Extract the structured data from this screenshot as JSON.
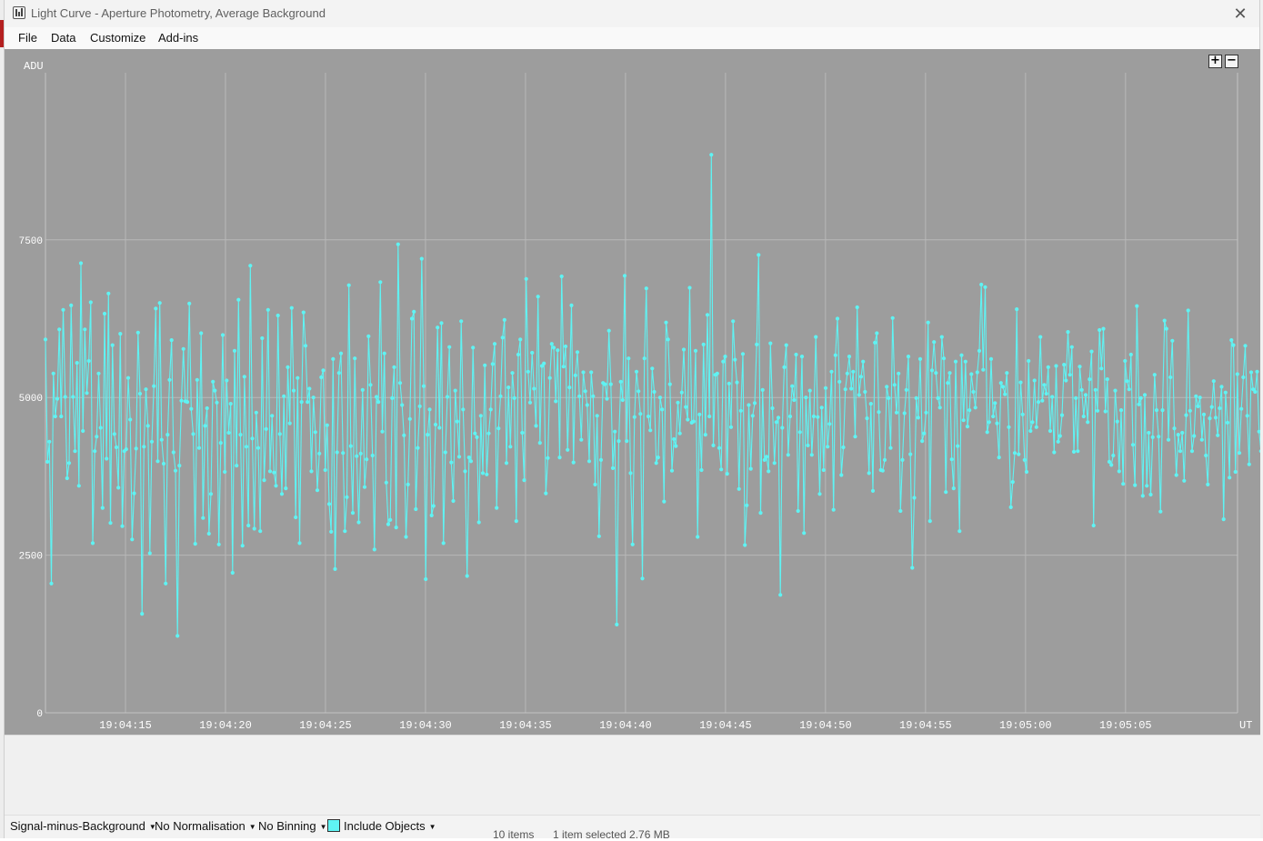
{
  "window": {
    "title": "Light Curve - Aperture Photometry, Average Background",
    "close_glyph": "✕"
  },
  "menu": [
    "File",
    "Data",
    "Customize",
    "Add-ins"
  ],
  "plot": {
    "zoom_in": "+",
    "zoom_out": "−"
  },
  "statusbar": {
    "signal_mode": "Signal-minus-Background",
    "normalisation": "No Normalisation",
    "binning": "No Binning",
    "include_objects": "Include Objects",
    "include_objects_color": "#5ff3f3"
  },
  "background_peek": {
    "items": "10 items",
    "selected": "1 item selected  2.76 MB"
  },
  "chart_data": {
    "type": "line",
    "ylabel": "ADU",
    "xlabel": "UT",
    "ylim": [
      0,
      10150
    ],
    "xlim": [
      "19:04:11.0",
      "19:05:10.6"
    ],
    "yticks": [
      0,
      2500,
      5000,
      7500
    ],
    "xticks": [
      "19:04:15",
      "19:04:20",
      "19:04:25",
      "19:04:30",
      "19:04:35",
      "19:04:40",
      "19:04:45",
      "19:04:50",
      "19:04:55",
      "19:05:00",
      "19:05:05"
    ],
    "grid": true,
    "series_color": "#5ff3f3",
    "point_interval_s": 0.0985,
    "series": [
      {
        "values": [
          5920,
          3980,
          4300,
          2050,
          5380,
          4700,
          4980,
          6080,
          4700,
          6390,
          5010,
          3720,
          3960,
          6460,
          5010,
          4150,
          5550,
          3600,
          7130,
          4470,
          6080,
          5070,
          5580,
          6510,
          2690,
          4150,
          4380,
          5380,
          4520,
          3250,
          6330,
          4030,
          6650,
          3010,
          5830,
          4420,
          4210,
          3570,
          6010,
          2960,
          4150,
          4180,
          5310,
          4650,
          2750,
          3480,
          4190,
          6030,
          5060,
          1570,
          4220,
          5130,
          4550,
          2530,
          4300,
          5180,
          6410,
          3990,
          6500,
          4330,
          3950,
          2050,
          4410,
          5280,
          5910,
          4130,
          3840,
          1220,
          3920,
          4950,
          5770,
          4940,
          4930,
          6490,
          4820,
          4420,
          2680,
          5280,
          4200,
          6020,
          3090,
          4550,
          4830,
          2840,
          3470,
          5250,
          5110,
          4920,
          2670,
          4280,
          5990,
          3820,
          5270,
          4440,
          4900,
          2220,
          5740,
          3920,
          6550,
          4410,
          2650,
          5330,
          4220,
          2970,
          7090,
          4350,
          2920,
          4760,
          4200,
          2880,
          5940,
          3690,
          4500,
          6390,
          3830,
          4710,
          3810,
          3600,
          6300,
          4420,
          3470,
          5020,
          3560,
          5480,
          4590,
          6420,
          5110,
          3100,
          5310,
          2690,
          4930,
          6350,
          5820,
          4930,
          5140,
          3830,
          5000,
          4450,
          3530,
          4110,
          5320,
          5430,
          3850,
          4560,
          3310,
          2870,
          5610,
          2280,
          4130,
          5390,
          5700,
          4120,
          2880,
          3420,
          6780,
          4230,
          3170,
          5620,
          4070,
          3020,
          4110,
          5120,
          3580,
          4020,
          5970,
          5200,
          4080,
          2590,
          5010,
          4930,
          6830,
          4460,
          5700,
          3650,
          2990,
          3060,
          4990,
          5480,
          2940,
          7430,
          5230,
          4880,
          4400,
          2790,
          3620,
          4660,
          6250,
          6360,
          3230,
          4200,
          4860,
          7200,
          5180,
          2120,
          4410,
          4810,
          3130,
          3280,
          4570,
          6110,
          4520,
          6180,
          2690,
          4130,
          5010,
          5800,
          3970,
          3360,
          5110,
          4620,
          4060,
          6210,
          4810,
          3830,
          2170,
          4050,
          3990,
          5790,
          4430,
          4370,
          3020,
          4710,
          3800,
          5510,
          3780,
          4430,
          4810,
          5530,
          5850,
          3250,
          4510,
          5020,
          5950,
          6230,
          3960,
          5160,
          4220,
          5390,
          4990,
          3040,
          5680,
          5920,
          4440,
          3690,
          6880,
          5410,
          4920,
          5710,
          5140,
          4550,
          6600,
          4280,
          5500,
          5540,
          3480,
          4040,
          5310,
          5850,
          5790,
          4940,
          5750,
          4050,
          6920,
          5490,
          5810,
          4170,
          5160,
          6460,
          3970,
          5350,
          5720,
          5020,
          4330,
          5400,
          5100,
          4880,
          3990,
          5400,
          5020,
          3620,
          4710,
          2800,
          4010,
          5230,
          5210,
          4980,
          6060,
          5210,
          3880,
          4460,
          1400,
          4310,
          5250,
          4960,
          6930,
          4310,
          5620,
          3800,
          2670,
          4690,
          5410,
          5100,
          4740,
          2130,
          5620,
          6730,
          4700,
          4480,
          5460,
          5090,
          3960,
          4050,
          5000,
          4810,
          3350,
          6190,
          5920,
          5210,
          3840,
          4340,
          4230,
          4920,
          4430,
          5080,
          5760,
          4850,
          4650,
          6740,
          4600,
          4620,
          5740,
          2790,
          4730,
          3850,
          5840,
          4410,
          6310,
          4700,
          8850,
          4240,
          5360,
          5380,
          4200,
          3860,
          5570,
          5650,
          3790,
          5220,
          4530,
          6210,
          5600,
          5240,
          3550,
          4790,
          5690,
          2660,
          3290,
          4880,
          3870,
          4710,
          4910,
          5840,
          7260,
          3170,
          5120,
          4010,
          4060,
          3830,
          5860,
          4830,
          3960,
          4610,
          4680,
          1870,
          4520,
          5480,
          5830,
          4090,
          4700,
          5180,
          4960,
          5680,
          3200,
          4450,
          5650,
          2850,
          5000,
          4240,
          5110,
          4090,
          4700,
          5960,
          4690,
          3470,
          4840,
          3850,
          5150,
          4220,
          4580,
          5410,
          3220,
          5670,
          6250,
          5250,
          3770,
          4210,
          5130,
          5380,
          5650,
          5140,
          5410,
          4380,
          6430,
          5040,
          5330,
          5570,
          5090,
          4670,
          3800,
          4900,
          3520,
          5870,
          6020,
          4770,
          3850,
          3840,
          4010,
          5170,
          4990,
          4200,
          6260,
          5200,
          4760,
          5380,
          3200,
          4010,
          4750,
          5120,
          5650,
          4100,
          2300,
          3410,
          4990,
          4680,
          5610,
          4310,
          4430,
          4760,
          6190,
          3040,
          5430,
          5880,
          5390,
          4990,
          4840,
          5960,
          5620,
          3500,
          5230,
          5390,
          4020,
          3560,
          5570,
          4230,
          2880,
          5670,
          4640,
          5570,
          4540,
          4800,
          5370,
          5090,
          4840,
          5400,
          5740,
          6790,
          5440,
          6750,
          4450,
          4610,
          5610,
          4700,
          4910,
          4590,
          4050,
          5230,
          5170,
          5050,
          5390,
          4530,
          3260,
          3660,
          4120,
          6400,
          4100,
          5240,
          4730,
          4010,
          3820,
          5580,
          4470,
          4610,
          5270,
          4530,
          4930,
          5960,
          4950,
          5200,
          5060,
          5480,
          4470,
          5010,
          4130,
          5500,
          4300,
          4390,
          4720,
          5520,
          5270,
          6040,
          5360,
          5800,
          4140,
          4990,
          4150,
          5490,
          5120,
          4700,
          5040,
          4610,
          5290,
          5730,
          2970,
          5120,
          4790,
          6070,
          5460,
          6090,
          4780,
          5290,
          3980,
          3930,
          4080,
          5110,
          4620,
          3830,
          4800,
          3630,
          5580,
          5260,
          5130,
          5680,
          4250,
          3610,
          6450,
          4890,
          4990,
          3440,
          5040,
          3600,
          4440,
          3460,
          4370,
          5360,
          4800,
          4380,
          3190,
          4800,
          6220,
          6090,
          4330,
          5320,
          5900,
          4510,
          3770,
          4410,
          4150,
          4440,
          3680,
          4720,
          6380,
          4790,
          4150,
          4390,
          5020,
          4860,
          5000,
          4330,
          4730,
          4080,
          3620,
          4670,
          4850,
          5260,
          4680,
          4400,
          4830,
          5170,
          3070,
          5080,
          4600,
          3730,
          5910,
          5830,
          3820,
          5370,
          4120,
          4820,
          5320,
          5820,
          4710,
          3940,
          5400,
          5130,
          5090,
          5410,
          4460,
          4150,
          4810,
          4620,
          4120,
          4460,
          4600,
          4630,
          5040,
          4000,
          4860,
          4280,
          3420,
          3760,
          3030,
          5180,
          4640,
          4440,
          4890,
          4240,
          3690,
          4510,
          4670,
          4920,
          3740,
          5430,
          4490,
          4590,
          4450,
          4100,
          4440,
          3990,
          4820,
          4790,
          4540,
          3150,
          4440,
          4760,
          4300,
          4710,
          5390,
          5620,
          6430,
          4960,
          4790,
          3470,
          2650,
          4550,
          4470,
          5350,
          4330,
          4730,
          4910,
          3750,
          4550,
          4940,
          2880,
          4630,
          3620,
          5700,
          5180,
          5010,
          4170,
          3380,
          5000,
          2860,
          3730,
          5060,
          4160,
          4360,
          4840,
          4830,
          5320,
          5830,
          4600,
          4950,
          4430,
          5250,
          6020,
          5340,
          4110,
          4470,
          3950,
          3230,
          5490,
          4550,
          4010,
          4520,
          5050,
          3270,
          4390,
          4070,
          4800,
          4110,
          3810,
          4900,
          5310,
          5770,
          3240,
          4390,
          4050,
          3770,
          5960,
          3770,
          2860,
          4150,
          4380,
          4050,
          5340,
          3910,
          3040,
          4690,
          4570,
          5380,
          4620,
          4310,
          6110,
          4480,
          5180,
          4570,
          4960,
          3750,
          3720,
          3730,
          3890,
          3910,
          3660,
          4390,
          3250,
          4250,
          2690,
          4460,
          4250,
          4720,
          4330,
          5190,
          3710,
          3790,
          4660,
          3790,
          3770,
          5350,
          4760,
          5390,
          4020,
          4240,
          2780,
          4390,
          3470,
          4000,
          4490,
          3760,
          4270,
          4090,
          2620,
          3070,
          4020,
          3770,
          3100,
          5480,
          3290,
          4460,
          3550,
          3360,
          3930,
          3280,
          3680,
          4770,
          3330,
          5940,
          3700,
          4570,
          5390,
          4960,
          3170,
          3700,
          4310,
          3990,
          5270,
          3440,
          3470,
          6270,
          4070,
          4780,
          5140,
          3230,
          4160,
          5380,
          3180,
          5500,
          3780,
          5470,
          4440,
          5310,
          3350,
          4650,
          5080,
          3780,
          3460,
          4090,
          4830,
          3890,
          4870,
          2940,
          4020,
          4730,
          3540,
          3610,
          3090,
          3790,
          5270,
          3560,
          5080,
          4730,
          3980,
          3880,
          3050,
          3940,
          5260,
          4110,
          4490,
          4220,
          4470,
          4550,
          5440,
          4230,
          4250,
          4990,
          3110,
          4490,
          3120,
          4220,
          4010,
          4780,
          4580,
          4780,
          4540,
          5060,
          4400,
          4870,
          4310,
          2850,
          4120,
          5230,
          2730,
          4330,
          5610,
          3570,
          2720,
          5240,
          4570,
          3910,
          3420,
          4640,
          4940,
          5430,
          4700,
          4610,
          4960,
          4770,
          4550,
          3610,
          4490,
          4690,
          4010,
          3750,
          4820,
          4620,
          4450,
          4360,
          5110,
          5650,
          3580,
          4420,
          4560,
          4010,
          4570,
          4920,
          4390,
          4600,
          3220,
          5100,
          4060,
          3180,
          5520,
          4710,
          3580,
          3920,
          4460,
          4160,
          4140,
          4490,
          4010,
          4360,
          4550,
          4400,
          4860,
          5000,
          5290,
          3640,
          4680,
          4430,
          4020,
          5030,
          4100,
          3820,
          4980,
          4170,
          4370,
          4760,
          3570,
          5090,
          4830,
          3690,
          4030,
          3940,
          4230,
          4730,
          3940,
          4030,
          4320,
          4510,
          4500,
          4460,
          3930,
          5340,
          4060,
          4160,
          4520,
          3870,
          3190,
          4520,
          4370,
          4720,
          5010,
          3690,
          3540,
          4300,
          4930,
          4260,
          4410,
          4190,
          4000,
          5100,
          3590,
          3720,
          4060,
          3820,
          3520,
          3860,
          4990,
          4650
        ]
      }
    ]
  }
}
